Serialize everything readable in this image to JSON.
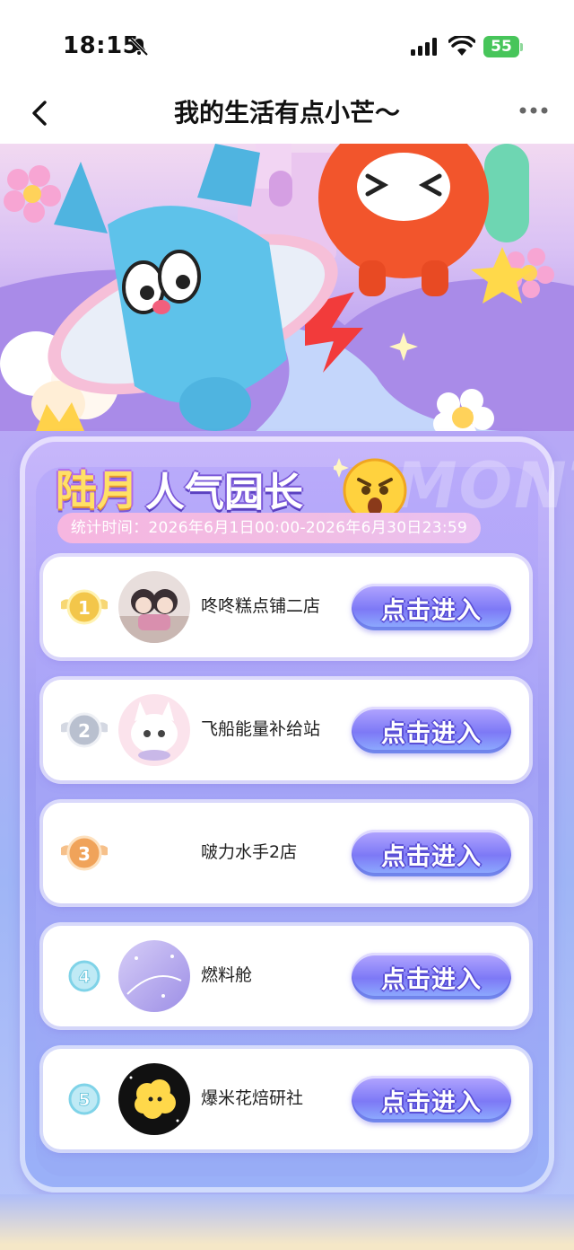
{
  "status_bar": {
    "time": "18:15",
    "battery": "55"
  },
  "nav": {
    "title": "我的生活有点小芒～"
  },
  "leaderboard": {
    "title_month": "陆月",
    "title_rest": "人气园长",
    "watermark": "MONTH",
    "period": "统计时间：2026年6月1日00:00-2026年6月30日23:59",
    "button_label": "点击进入",
    "entries": [
      {
        "rank": "1",
        "name": "咚咚糕点铺二店",
        "badge_color": "#f3c64a"
      },
      {
        "rank": "2",
        "name": "飞船能量补给站",
        "badge_color": "#b9c0cf"
      },
      {
        "rank": "3",
        "name": "啵力水手2店",
        "badge_color": "#f0a35a"
      },
      {
        "rank": "4",
        "name": "燃料舱",
        "badge_color": "#7fd3e8"
      },
      {
        "rank": "5",
        "name": "爆米花焙研社",
        "badge_color": "#7fd3e8"
      }
    ]
  },
  "icons": [
    "bell-muted-icon",
    "signal-icon",
    "wifi-icon",
    "battery-icon",
    "back-chevron-icon",
    "more-dots-icon"
  ]
}
